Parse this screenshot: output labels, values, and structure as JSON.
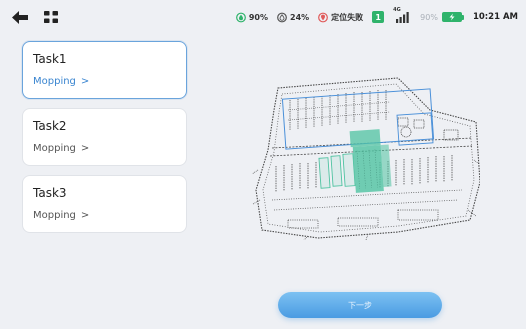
{
  "statusbar": {
    "water_level": "90%",
    "detergent_level": "24%",
    "location_status": "定位失败",
    "sim_label": "1",
    "network_type": "4G",
    "phone_battery": "90%",
    "time": "10:21 AM"
  },
  "tasks": [
    {
      "title": "Task1",
      "subtitle": "Mopping",
      "selected": true
    },
    {
      "title": "Task2",
      "subtitle": "Mopping",
      "selected": false
    },
    {
      "title": "Task3",
      "subtitle": "Mopping",
      "selected": false
    }
  ],
  "icons": {
    "back": "back-arrow-icon",
    "menu": "grid-menu-icon",
    "water": "water-drop-icon",
    "detergent": "detergent-drop-icon",
    "location": "location-pin-icon",
    "signal": "signal-bars-icon",
    "battery": "battery-icon",
    "chevron": "chevron-right-icon"
  },
  "colors": {
    "accent_blue": "#4a9be2",
    "selected_border": "#6aa4dc",
    "status_green": "#2fb36b",
    "location_red": "#e05a5a",
    "region_teal": "#4fc3a1"
  },
  "next_button": {
    "label": "下一步"
  }
}
